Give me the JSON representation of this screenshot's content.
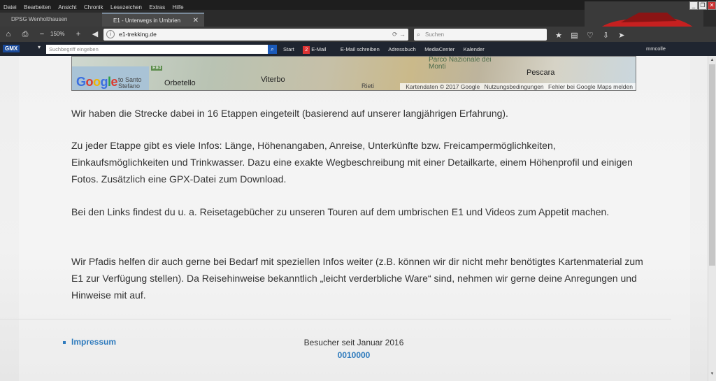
{
  "menu": [
    "Datei",
    "Bearbeiten",
    "Ansicht",
    "Chronik",
    "Lesezeichen",
    "Extras",
    "Hilfe"
  ],
  "tabs": [
    {
      "label": "DPSG Wenholthausen"
    },
    {
      "label": "E1 - Unterwegs in Umbrien"
    }
  ],
  "nav": {
    "zoom": "150%",
    "url": "e1-trekking.de",
    "search_placeholder": "Suchen"
  },
  "gmx_toolbar": {
    "brand": "GMX",
    "search_placeholder": "Suchbegriff eingeben",
    "links": [
      "Start",
      "E-Mail",
      "E-Mail schreiben",
      "Adressbuch",
      "MediaCenter",
      "Kalender"
    ],
    "mail_count": "2",
    "user": "mmcolle"
  },
  "map": {
    "labels": [
      "to Santo Stefano",
      "Orbetello",
      "E80",
      "Viterbo",
      "Parco Nazionale dei Monti",
      "Pescara",
      "Rieti"
    ],
    "attribution": [
      "Kartendaten © 2017 Google",
      "Nutzungsbedingungen",
      "Fehler bei Google Maps melden"
    ]
  },
  "paragraphs": [
    "Wir haben die Strecke dabei in 16 Etappen eingeteilt (basierend auf unserer langjährigen Erfahrung).",
    "Zu jeder Etappe gibt es viele Infos: Länge, Höhenangaben, Anreise, Unterkünfte bzw. Freicampermöglichkeiten, Einkaufsmöglichkeiten und Trinkwasser. Dazu eine exakte Wegbeschreibung mit einer Detailkarte, einem Höhenprofil und einigen Fotos. Zusätzlich eine GPX-Datei zum Download.",
    "Bei den Links findest du u. a. Reisetagebücher zu unseren Touren auf dem umbrischen E1 und Videos zum Appetit machen.",
    "Wir Pfadis helfen dir auch gerne bei Bedarf mit speziellen Infos weiter (z.B. können wir dir nicht mehr benötigtes Kartenmaterial zum E1 zur Verfügung stellen). Da Reisehinweise bekanntlich „leicht verderbliche Ware“ sind, nehmen wir gerne deine Anregungen und Hinweise mit auf."
  ],
  "footer": {
    "impressum": "Impressum",
    "visitors_label": "Besucher seit Januar 2016",
    "visitors_count": "0010000"
  },
  "colors": {
    "link": "#2f7bbd",
    "text": "#333333"
  }
}
